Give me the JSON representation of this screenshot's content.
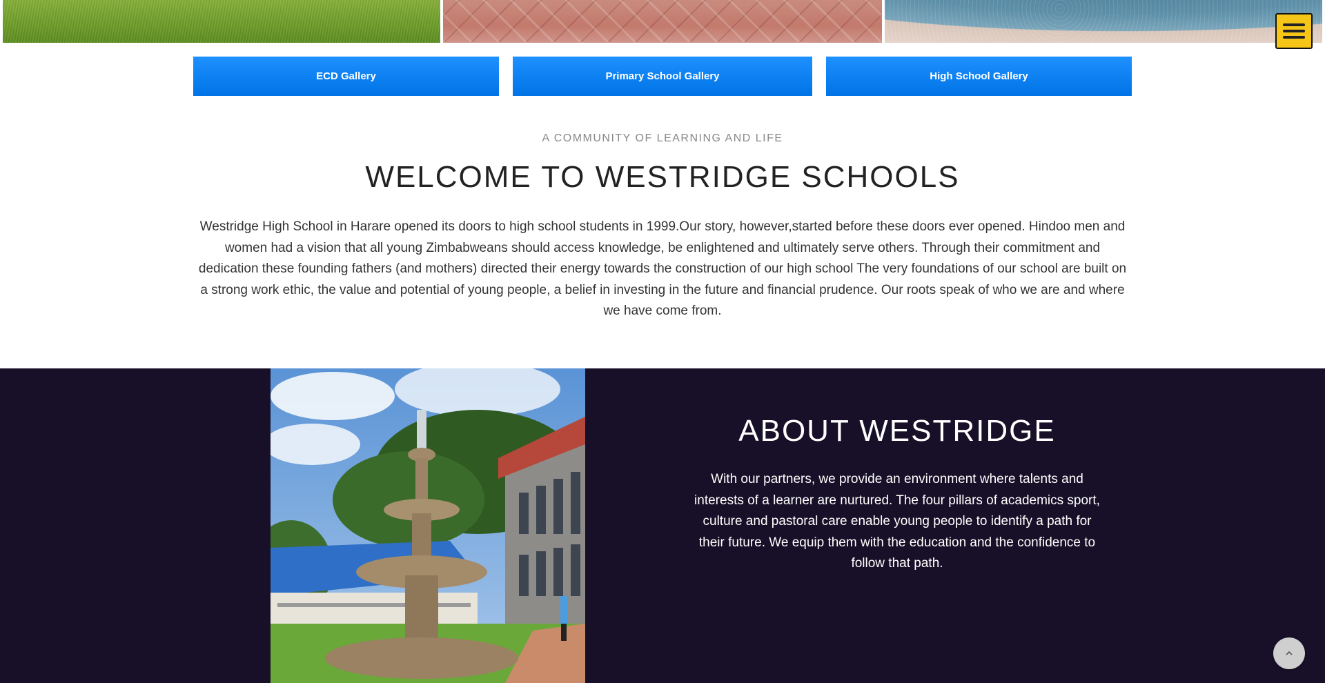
{
  "gallery": {
    "ecd_label": "ECD Gallery",
    "primary_label": "Primary School Gallery",
    "high_label": "High School Gallery",
    "button_color": "#0a84ff"
  },
  "welcome": {
    "eyebrow": "A COMMUNITY OF LEARNING AND LIFE",
    "title": "WELCOME TO WESTRIDGE SCHOOLS",
    "body": "Westridge High School in Harare opened its doors to high school students in 1999.Our story, however,started before these doors ever opened. Hindoo men and women had a vision that all young Zimbabweans should access knowledge, be enlightened and ultimately serve others. Through their commitment and dedication these founding fathers (and mothers) directed their energy towards the construction of our high school The very foundations of our school are built on a strong work ethic, the value and potential of young people, a belief in investing in the future and financial prudence. Our roots speak of who we are and where we have come from."
  },
  "about": {
    "title": "ABOUT WESTRIDGE",
    "body": "With our partners, we provide an environment where talents and interests of a learner are nurtured. The four pillars of academics sport, culture and pastoral care enable young people to identify a path for their future. We equip them with the education and the confidence to follow that path.",
    "background": "#181028"
  },
  "icons": {
    "menu": "hamburger-menu-icon",
    "scroll_top": "chevron-up-icon"
  },
  "colors": {
    "menu_button": "#f5c518"
  }
}
